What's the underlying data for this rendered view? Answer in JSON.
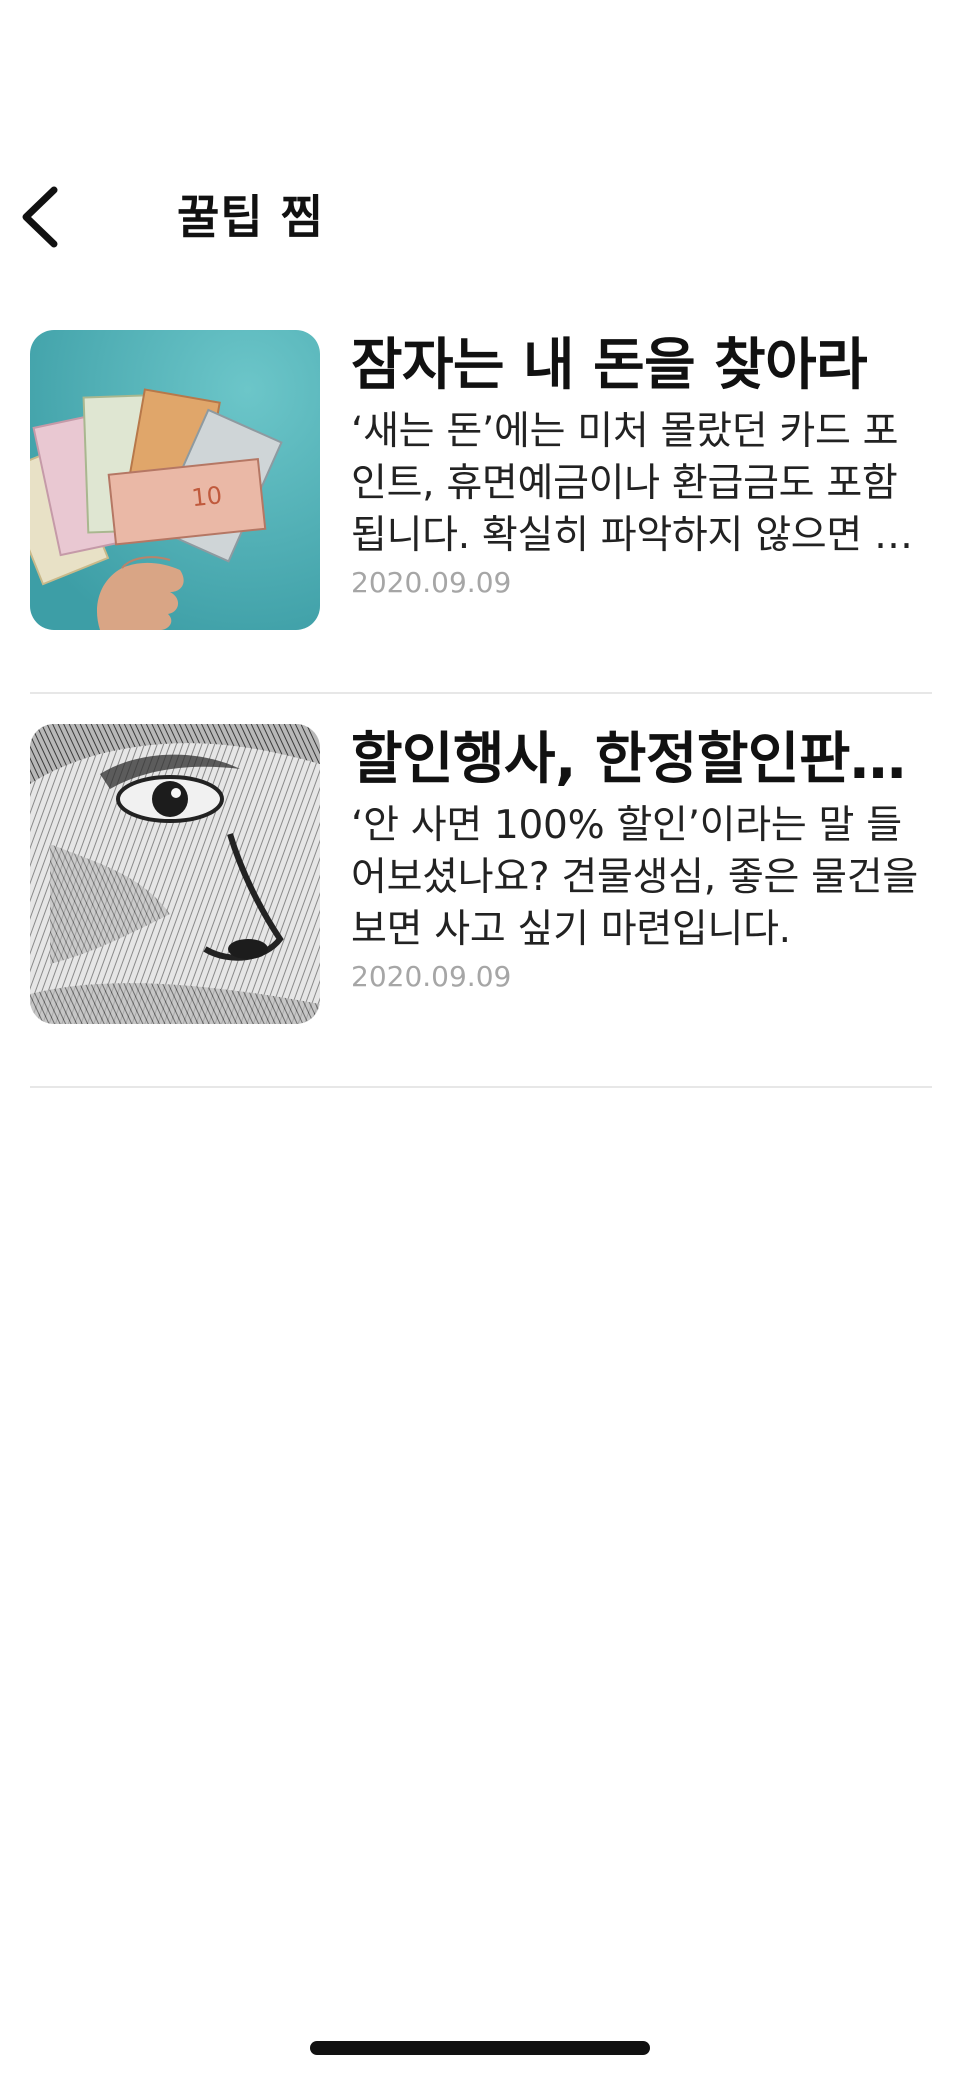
{
  "header": {
    "title": "꿀팁 찜",
    "back_icon": "chevron-left-icon"
  },
  "items": [
    {
      "title": "잠자는 내 돈을 찾아라",
      "description": "‘새는 돈’에는 미처 몰랐던 카드 포인트, 휴면예금이나 환급금도 포함됩니다. 확실히 파악하지 않으면 그냥 사라질 수 있습니다.",
      "date": "2020.09.09",
      "thumbnail": "hand-holding-banknotes-image",
      "thumbnail_bg": "#4fb0b6"
    },
    {
      "title": "할인행사, 한정할인판매의 함정",
      "description": "‘안 사면 100% 할인’이라는 말 들어보셨나요? 견물생심, 좋은 물건을 보면 사고 싶기 마련입니다.",
      "date": "2020.09.09",
      "thumbnail": "banknote-portrait-engraving-image",
      "thumbnail_bg": "#d8d8d8"
    }
  ],
  "colors": {
    "text_primary": "#111111",
    "text_date": "#a6a6a6",
    "divider": "#e7e7e7"
  }
}
